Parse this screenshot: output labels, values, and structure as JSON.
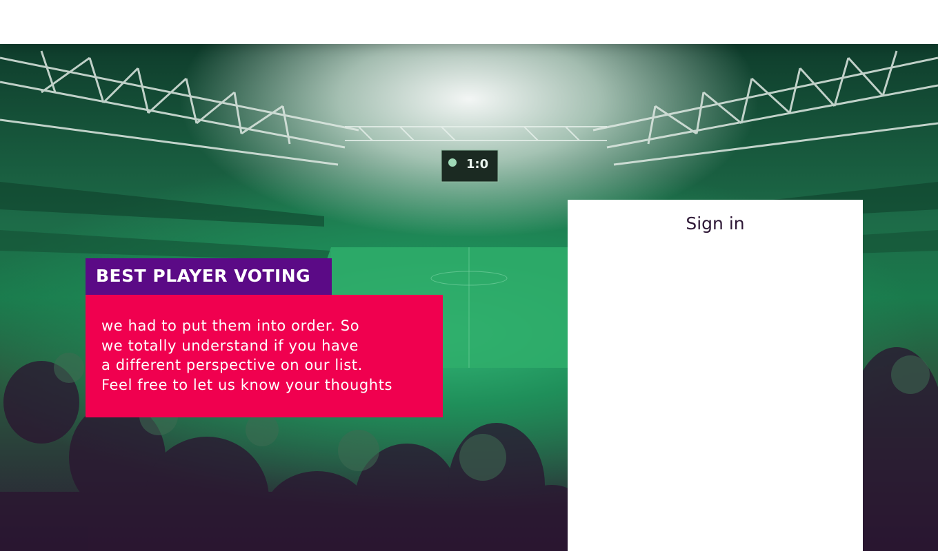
{
  "promo": {
    "title": "BEST PLAYER VOTING",
    "lines": [
      "we had to put them into order. So",
      "we totally understand if you have",
      "a different perspective on our list.",
      "Feel free to let us know your thoughts"
    ]
  },
  "signin": {
    "title": "Sign in"
  },
  "scoreboard": {
    "score": "1:0"
  },
  "colors": {
    "promo_title_bg": "#5b0a86",
    "promo_body_bg": "#f0004f",
    "signin_text": "#2e1836"
  }
}
